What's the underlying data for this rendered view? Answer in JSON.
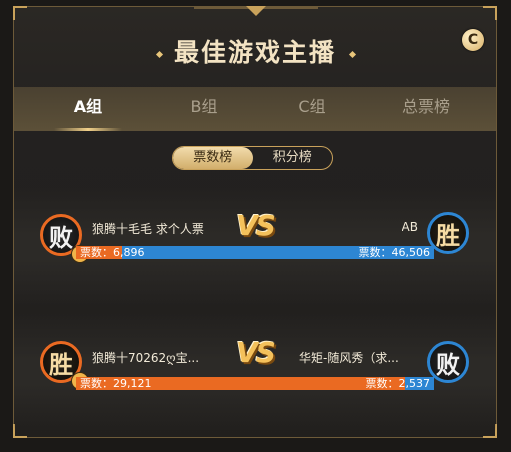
{
  "header": {
    "title": "最佳游戏主播",
    "refresh_icon": "C"
  },
  "tabs": [
    {
      "label": "A组",
      "active": true
    },
    {
      "label": "B组",
      "active": false
    },
    {
      "label": "C组",
      "active": false
    },
    {
      "label": "总票榜",
      "active": false
    }
  ],
  "segment": {
    "votes_label": "票数榜",
    "points_label": "积分榜",
    "active": "votes"
  },
  "colors": {
    "orange": "#ea6a22",
    "blue": "#2d86d3",
    "gold": "#c9a25b"
  },
  "matches": [
    {
      "left": {
        "name": "狼腾十毛毛 求个人票",
        "result": "败",
        "votes_label": "票数：6,896"
      },
      "vs": "VS",
      "right": {
        "name": "AB",
        "result": "胜",
        "votes_label": "票数：46,506"
      },
      "left_share": 0.129
    },
    {
      "left": {
        "name": "狼腾十70262ღ宝...",
        "result": "胜",
        "votes_label": "票数：29,121"
      },
      "vs": "VS",
      "right": {
        "name": "华矩-随风秀（求...",
        "result": "败",
        "votes_label": "票数：2,537"
      },
      "left_share": 0.92
    }
  ]
}
